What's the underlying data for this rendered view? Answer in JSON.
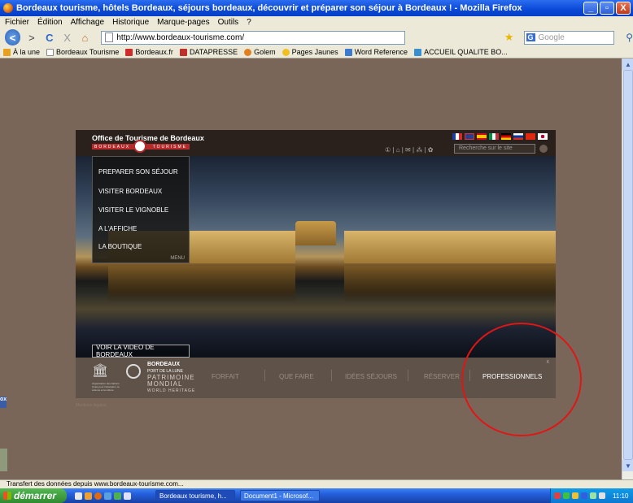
{
  "window": {
    "title": "Bordeaux tourisme, hôtels Bordeaux, séjours bordeaux, découvrir et préparer son séjour à Bordeaux ! - Mozilla Firefox",
    "minimize": "_",
    "maximize": "▫",
    "close": "X"
  },
  "menu": [
    "Fichier",
    "Édition",
    "Affichage",
    "Historique",
    "Marque-pages",
    "Outils",
    "?"
  ],
  "nav": {
    "back": "<",
    "forward": ">",
    "reload": "C",
    "stop": "X",
    "home": "⌂",
    "url": "http://www.bordeaux-tourisme.com/",
    "search_engine": "G",
    "search_placeholder": "Google"
  },
  "bookmarks": [
    {
      "label": "À la une",
      "color": "#e8a020"
    },
    {
      "label": "Bordeaux Tourisme",
      "color": "#ffffff"
    },
    {
      "label": "Bordeaux.fr",
      "color": "#d02a2a"
    },
    {
      "label": "DATAPRESSE",
      "color": "#c0302a"
    },
    {
      "label": "Golem",
      "color": "#e08020"
    },
    {
      "label": "Pages Jaunes",
      "color": "#f0c020"
    },
    {
      "label": "Word Reference",
      "color": "#3a7ad0"
    },
    {
      "label": "ACCUEIL QUALITE BO...",
      "color": "#3a8fd0"
    }
  ],
  "site": {
    "office_title": "Office de Tourisme de Bordeaux",
    "logo_left": "BORDEAUX",
    "logo_right": "TOURISME",
    "search_placeholder": "Recherche sur le site",
    "tools": "① | ⌂ | ✉ | ⁂ | ✿",
    "menu_items": [
      "PREPARER SON SÉJOUR",
      "VISITER BORDEAUX",
      "VISITER LE VIGNOBLE",
      "A L'AFFICHE",
      "LA BOUTIQUE"
    ],
    "menu_footer": "MENU",
    "video_button": "VOIR LA VIDEO DE BORDEAUX",
    "brand_line1": "BORDEAUX",
    "brand_line2": "PORT DE LA LUNE",
    "patrimoine_line1": "PATRIMOINE",
    "patrimoine_line2": "MONDIAL",
    "patrimoine_line3": "WORLD HERITAGE",
    "unesco_text": "Organisation des Nations Unies pour l'éducation, la science et la culture",
    "bottom_nav": [
      "FORFAIT",
      "QUE FAIRE",
      "IDÉES SÉJOURS",
      "RÉSERVER",
      "PROFESSIONNELS"
    ],
    "active_nav": "PROFESSIONNELS",
    "close_x": "x",
    "mentions": "Mentions légales"
  },
  "statusbar": "Transfert des données depuis www.bordeaux-tourisme.com...",
  "taskbar": {
    "start": "démarrer",
    "tasks": [
      "Bordeaux tourisme, h...",
      "Document1 - Microsof..."
    ],
    "clock": "11:10"
  },
  "colors": {
    "accent_circle": "#e01616",
    "page_bg": "#7a6658",
    "xp_blue": "#0a48d6"
  }
}
